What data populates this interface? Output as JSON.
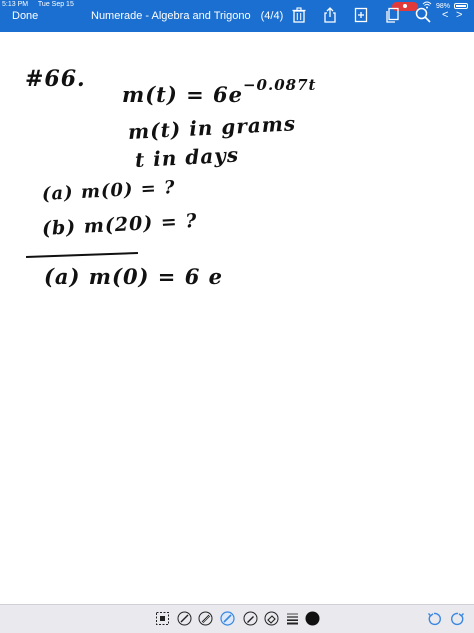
{
  "status_bar": {
    "time": "5:13 PM",
    "date": "Tue Sep 15",
    "battery": "98%"
  },
  "toolbar": {
    "done_label": "Done",
    "title": "Numerade - Algebra and Trigono",
    "page_count": "(4/4)",
    "nav_prev": "<",
    "nav_next": ">"
  },
  "notes": {
    "problem_number": "#66.",
    "equation_lhs": "m(t) = 6e",
    "equation_exponent": "−0.087t",
    "unit_line_1": "m(t) in grams",
    "unit_line_2": "t in days",
    "part_a_question": "(a) m(0) = ?",
    "part_b_question": "(b) m(20) = ?",
    "part_a_answer": "(a) m(0) = 6 e"
  },
  "colors": {
    "toolbar_bg": "#1b6fd1",
    "bottom_bar_bg": "#e9e9ee",
    "active_tool": "#3a87e0",
    "ink": "#111111"
  }
}
